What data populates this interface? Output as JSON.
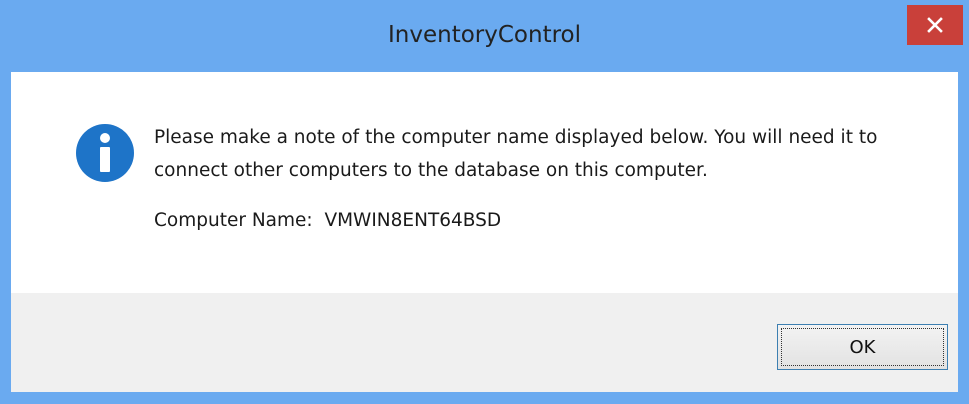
{
  "window": {
    "title": "InventoryControl",
    "close_symbol": "✕"
  },
  "dialog": {
    "icon": "info-icon",
    "message": "Please make a note of the computer name displayed below.  You will need it to connect other computers to the database on this computer.",
    "computer_name_label": "Computer Name:",
    "computer_name_value": "VMWIN8ENT64BSD"
  },
  "buttons": {
    "ok_label": "OK"
  },
  "colors": {
    "titlebar": "#6aaaf0",
    "close_button": "#c9403a",
    "info_icon": "#1e74c8",
    "footer": "#f0f0f0"
  }
}
